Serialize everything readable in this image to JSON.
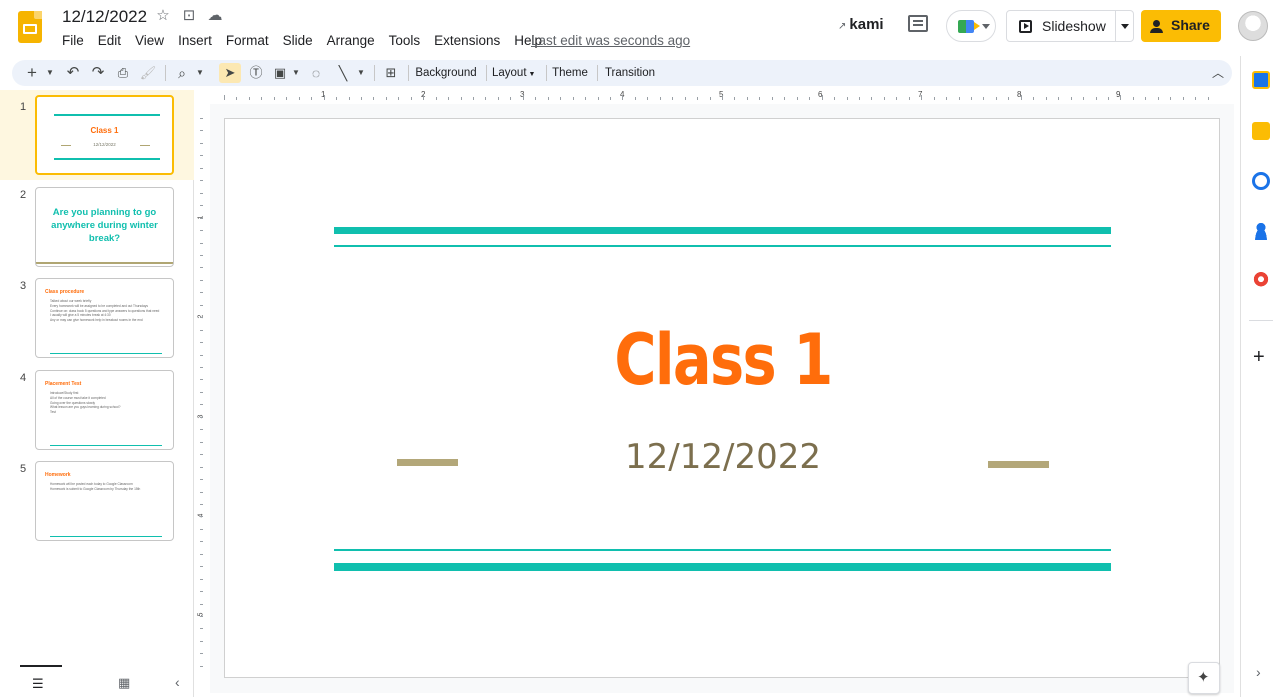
{
  "app": {
    "title": "12/12/2022",
    "last_edit": "Last edit was seconds ago"
  },
  "menu": [
    "File",
    "Edit",
    "View",
    "Insert",
    "Format",
    "Slide",
    "Arrange",
    "Tools",
    "Extensions",
    "Help"
  ],
  "header": {
    "kami_label": "kami",
    "slideshow_label": "Slideshow",
    "share_label": "Share"
  },
  "toolbar": {
    "background_label": "Background",
    "layout_label": "Layout",
    "theme_label": "Theme",
    "transition_label": "Transition"
  },
  "ruler": {
    "h_labels": [
      "1",
      "2",
      "3",
      "4",
      "5",
      "6",
      "7",
      "8",
      "9"
    ],
    "v_labels": [
      "1",
      "2",
      "3",
      "4",
      "5"
    ]
  },
  "slides": [
    {
      "number": "1",
      "title": "Class 1",
      "subtitle": "12/12/2022"
    },
    {
      "number": "2",
      "title": "Are you planning to go anywhere during winter break?"
    },
    {
      "number": "3",
      "title": "Class procedure",
      "bullets": [
        "Talked about our week briefly",
        "Every homework will be assigned to be completed and out Thursdays",
        "Continue on: class book 5 questions and type answers to questions that need",
        "I usually will give a 5 minutes break at 4:30",
        "Any or may can give homework help in breakout rooms in the end"
      ]
    },
    {
      "number": "4",
      "title": "Placement Test",
      "bullets": [
        "Introduce/Study first",
        "All of the course must take it completed",
        "Going over the questions slowly",
        "What lesson are you guys learning during school?",
        "Test"
      ]
    },
    {
      "number": "5",
      "title": "Homework",
      "bullets": [
        "Homework will be posted each today to Google Classroom",
        "Homework is submit to Google Classroom by Thursday the 15th"
      ]
    }
  ],
  "current_slide": {
    "title": "Class 1",
    "date": "12/12/2022"
  },
  "colors": {
    "accent_teal": "#10bfae",
    "title_orange": "#ff6d0b",
    "date_brown": "#7c6f4e",
    "dash_khaki": "#b3a779",
    "share_yellow": "#fbbc04"
  }
}
